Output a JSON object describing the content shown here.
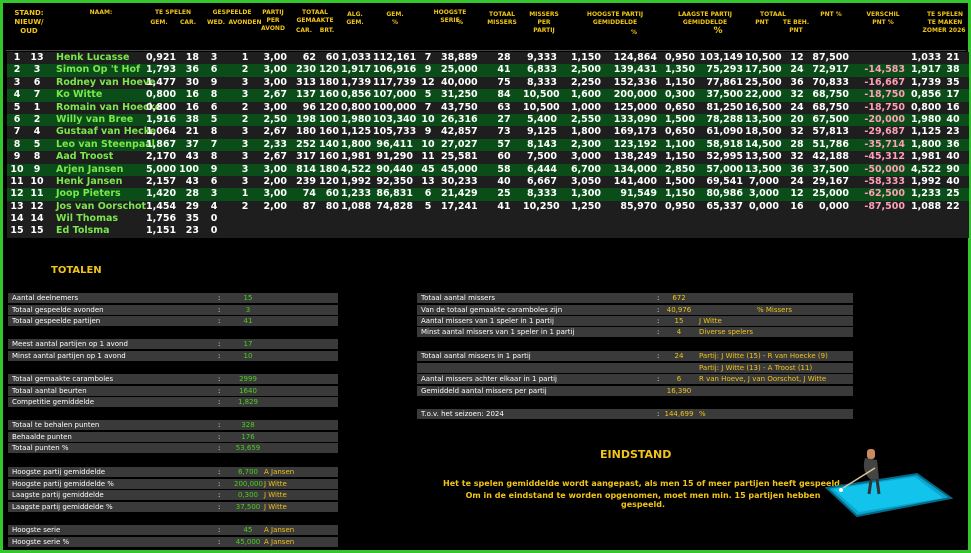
{
  "header": {
    "stand": "STAND:",
    "nieuw_oud": "NIEUW/ OUD",
    "naam": "NAAM:",
    "te_spelen": "TE SPELEN",
    "gem": "GEM.",
    "car": "CAR.",
    "gespeelde": "GESPEELDE",
    "wed": "WED.",
    "avonden": "AVONDEN",
    "partij_per_avond": "PARTIJ PER AVOND",
    "totaal_gemaakte": "TOTAAL GEMAAKTE",
    "car2": "CAR.",
    "brt": "BRT.",
    "alg_gem": "ALG. GEM.",
    "gem_pct": "GEM. %",
    "hoogste_serie": "HOOGSTE SERIE",
    "pct": "%",
    "totaal_missers": "TOTAAL MISSERS",
    "missers_per_partij": "MISSERS PER PARTIJ",
    "hoogste_partij_gemiddelde": "HOOGSTE PARTIJ GEMIDDELDE",
    "pct2": "%",
    "laagste_partij_gemiddelde": "LAAGSTE PARTIJ GEMIDDELDE",
    "pct3": "%",
    "totaal": "TOTAAL",
    "pnt": "PNT",
    "te_beh_pnt": "TE BEH. PNT",
    "pnt_pct": "PNT %",
    "verschil_pnt_pct": "VERSCHIL PNT %",
    "te_spelen_te_maken": "TE SPELEN TE MAKEN",
    "zomer": "ZOMER 2026"
  },
  "rows": [
    {
      "nieuw": "1",
      "oud": "13",
      "naam": "Henk Lucasse",
      "gem": "0,921",
      "car": "18",
      "wed": "3",
      "avonden": "1",
      "ppa": "3,00",
      "tcar": "62",
      "tbrt": "60",
      "alg": "1,033",
      "gpct": "112,161",
      "hs": "7",
      "hspct": "38,889",
      "miss": "28",
      "mpp": "9,333",
      "hpg": "1,150",
      "hpgpct": "124,864",
      "lpg": "0,950",
      "lpgpct": "103,149",
      "pnt": "10,500",
      "tbp": "12",
      "pntpct": "87,500",
      "versch": "",
      "zgem": "1,033",
      "zcar": "21"
    },
    {
      "nieuw": "2",
      "oud": "3",
      "naam": "Simon Op 't Hof",
      "gem": "1,793",
      "car": "36",
      "wed": "6",
      "avonden": "2",
      "ppa": "3,00",
      "tcar": "230",
      "tbrt": "120",
      "alg": "1,917",
      "gpct": "106,916",
      "hs": "9",
      "hspct": "25,000",
      "miss": "41",
      "mpp": "6,833",
      "hpg": "2,500",
      "hpgpct": "139,431",
      "lpg": "1,350",
      "lpgpct": "75,293",
      "pnt": "17,500",
      "tbp": "24",
      "pntpct": "72,917",
      "versch": "-14,583",
      "zgem": "1,917",
      "zcar": "38"
    },
    {
      "nieuw": "3",
      "oud": "6",
      "naam": "Rodney van Hoeve",
      "gem": "1,477",
      "car": "30",
      "wed": "9",
      "avonden": "3",
      "ppa": "3,00",
      "tcar": "313",
      "tbrt": "180",
      "alg": "1,739",
      "gpct": "117,739",
      "hs": "12",
      "hspct": "40,000",
      "miss": "75",
      "mpp": "8,333",
      "hpg": "2,250",
      "hpgpct": "152,336",
      "lpg": "1,150",
      "lpgpct": "77,861",
      "pnt": "25,500",
      "tbp": "36",
      "pntpct": "70,833",
      "versch": "-16,667",
      "zgem": "1,739",
      "zcar": "35"
    },
    {
      "nieuw": "4",
      "oud": "7",
      "naam": "Ko Witte",
      "gem": "0,800",
      "car": "16",
      "wed": "8",
      "avonden": "3",
      "ppa": "2,67",
      "tcar": "137",
      "tbrt": "160",
      "alg": "0,856",
      "gpct": "107,000",
      "hs": "5",
      "hspct": "31,250",
      "miss": "84",
      "mpp": "10,500",
      "hpg": "1,600",
      "hpgpct": "200,000",
      "lpg": "0,300",
      "lpgpct": "37,500",
      "pnt": "22,000",
      "tbp": "32",
      "pntpct": "68,750",
      "versch": "-18,750",
      "zgem": "0,856",
      "zcar": "17"
    },
    {
      "nieuw": "5",
      "oud": "1",
      "naam": "Romain van Hoecke",
      "gem": "0,800",
      "car": "16",
      "wed": "6",
      "avonden": "2",
      "ppa": "3,00",
      "tcar": "96",
      "tbrt": "120",
      "alg": "0,800",
      "gpct": "100,000",
      "hs": "7",
      "hspct": "43,750",
      "miss": "63",
      "mpp": "10,500",
      "hpg": "1,000",
      "hpgpct": "125,000",
      "lpg": "0,650",
      "lpgpct": "81,250",
      "pnt": "16,500",
      "tbp": "24",
      "pntpct": "68,750",
      "versch": "-18,750",
      "zgem": "0,800",
      "zcar": "16"
    },
    {
      "nieuw": "6",
      "oud": "2",
      "naam": "Willy van Bree",
      "gem": "1,916",
      "car": "38",
      "wed": "5",
      "avonden": "2",
      "ppa": "2,50",
      "tcar": "198",
      "tbrt": "100",
      "alg": "1,980",
      "gpct": "103,340",
      "hs": "10",
      "hspct": "26,316",
      "miss": "27",
      "mpp": "5,400",
      "hpg": "2,550",
      "hpgpct": "133,090",
      "lpg": "1,500",
      "lpgpct": "78,288",
      "pnt": "13,500",
      "tbp": "20",
      "pntpct": "67,500",
      "versch": "-20,000",
      "zgem": "1,980",
      "zcar": "40"
    },
    {
      "nieuw": "7",
      "oud": "4",
      "naam": "Gustaaf van Hecke",
      "gem": "1,064",
      "car": "21",
      "wed": "8",
      "avonden": "3",
      "ppa": "2,67",
      "tcar": "180",
      "tbrt": "160",
      "alg": "1,125",
      "gpct": "105,733",
      "hs": "9",
      "hspct": "42,857",
      "miss": "73",
      "mpp": "9,125",
      "hpg": "1,800",
      "hpgpct": "169,173",
      "lpg": "0,650",
      "lpgpct": "61,090",
      "pnt": "18,500",
      "tbp": "32",
      "pntpct": "57,813",
      "versch": "-29,687",
      "zgem": "1,125",
      "zcar": "23"
    },
    {
      "nieuw": "8",
      "oud": "5",
      "naam": "Leo van Steenpaal",
      "gem": "1,867",
      "car": "37",
      "wed": "7",
      "avonden": "3",
      "ppa": "2,33",
      "tcar": "252",
      "tbrt": "140",
      "alg": "1,800",
      "gpct": "96,411",
      "hs": "10",
      "hspct": "27,027",
      "miss": "57",
      "mpp": "8,143",
      "hpg": "2,300",
      "hpgpct": "123,192",
      "lpg": "1,100",
      "lpgpct": "58,918",
      "pnt": "14,500",
      "tbp": "28",
      "pntpct": "51,786",
      "versch": "-35,714",
      "zgem": "1,800",
      "zcar": "36"
    },
    {
      "nieuw": "9",
      "oud": "8",
      "naam": "Aad Troost",
      "gem": "2,170",
      "car": "43",
      "wed": "8",
      "avonden": "3",
      "ppa": "2,67",
      "tcar": "317",
      "tbrt": "160",
      "alg": "1,981",
      "gpct": "91,290",
      "hs": "11",
      "hspct": "25,581",
      "miss": "60",
      "mpp": "7,500",
      "hpg": "3,000",
      "hpgpct": "138,249",
      "lpg": "1,150",
      "lpgpct": "52,995",
      "pnt": "13,500",
      "tbp": "32",
      "pntpct": "42,188",
      "versch": "-45,312",
      "zgem": "1,981",
      "zcar": "40"
    },
    {
      "nieuw": "10",
      "oud": "9",
      "naam": "Arjen Jansen",
      "gem": "5,000",
      "car": "100",
      "wed": "9",
      "avonden": "3",
      "ppa": "3,00",
      "tcar": "814",
      "tbrt": "180",
      "alg": "4,522",
      "gpct": "90,440",
      "hs": "45",
      "hspct": "45,000",
      "miss": "58",
      "mpp": "6,444",
      "hpg": "6,700",
      "hpgpct": "134,000",
      "lpg": "2,850",
      "lpgpct": "57,000",
      "pnt": "13,500",
      "tbp": "36",
      "pntpct": "37,500",
      "versch": "-50,000",
      "zgem": "4,522",
      "zcar": "90"
    },
    {
      "nieuw": "11",
      "oud": "10",
      "naam": "Henk Jansen",
      "gem": "2,157",
      "car": "43",
      "wed": "6",
      "avonden": "3",
      "ppa": "2,00",
      "tcar": "239",
      "tbrt": "120",
      "alg": "1,992",
      "gpct": "92,350",
      "hs": "13",
      "hspct": "30,233",
      "miss": "40",
      "mpp": "6,667",
      "hpg": "3,050",
      "hpgpct": "141,400",
      "lpg": "1,500",
      "lpgpct": "69,541",
      "pnt": "7,000",
      "tbp": "24",
      "pntpct": "29,167",
      "versch": "-58,333",
      "zgem": "1,992",
      "zcar": "40"
    },
    {
      "nieuw": "12",
      "oud": "11",
      "naam": "Joop Pieters",
      "gem": "1,420",
      "car": "28",
      "wed": "3",
      "avonden": "1",
      "ppa": "3,00",
      "tcar": "74",
      "tbrt": "60",
      "alg": "1,233",
      "gpct": "86,831",
      "hs": "6",
      "hspct": "21,429",
      "miss": "25",
      "mpp": "8,333",
      "hpg": "1,300",
      "hpgpct": "91,549",
      "lpg": "1,150",
      "lpgpct": "80,986",
      "pnt": "3,000",
      "tbp": "12",
      "pntpct": "25,000",
      "versch": "-62,500",
      "zgem": "1,233",
      "zcar": "25"
    },
    {
      "nieuw": "13",
      "oud": "12",
      "naam": "Jos van Oorschot",
      "gem": "1,454",
      "car": "29",
      "wed": "4",
      "avonden": "2",
      "ppa": "2,00",
      "tcar": "87",
      "tbrt": "80",
      "alg": "1,088",
      "gpct": "74,828",
      "hs": "5",
      "hspct": "17,241",
      "miss": "41",
      "mpp": "10,250",
      "hpg": "1,250",
      "hpgpct": "85,970",
      "lpg": "0,950",
      "lpgpct": "65,337",
      "pnt": "0,000",
      "tbp": "16",
      "pntpct": "0,000",
      "versch": "-87,500",
      "zgem": "1,088",
      "zcar": "22"
    },
    {
      "nieuw": "14",
      "oud": "14",
      "naam": "Wil Thomas",
      "gem": "1,756",
      "car": "35",
      "wed": "0",
      "avonden": "",
      "ppa": "",
      "tcar": "",
      "tbrt": "",
      "alg": "",
      "gpct": "",
      "hs": "",
      "hspct": "",
      "miss": "",
      "mpp": "",
      "hpg": "",
      "hpgpct": "",
      "lpg": "",
      "lpgpct": "",
      "pnt": "",
      "tbp": "",
      "pntpct": "",
      "versch": "",
      "zgem": "",
      "zcar": ""
    },
    {
      "nieuw": "15",
      "oud": "15",
      "naam": "Ed Tolsma",
      "gem": "1,151",
      "car": "23",
      "wed": "0",
      "avonden": "",
      "ppa": "",
      "tcar": "",
      "tbrt": "",
      "alg": "",
      "gpct": "",
      "hs": "",
      "hspct": "",
      "miss": "",
      "mpp": "",
      "hpg": "",
      "hpgpct": "",
      "lpg": "",
      "lpgpct": "",
      "pnt": "",
      "tbp": "",
      "pntpct": "",
      "versch": "",
      "zgem": "",
      "zcar": ""
    }
  ],
  "totalen": {
    "title": "TOTALEN",
    "items": [
      {
        "label": "Aantal deelnemers",
        "sep": ":",
        "value": "15",
        "name": ""
      },
      {
        "label": "Totaal gespeelde avonden",
        "sep": ":",
        "value": "3",
        "name": ""
      },
      {
        "label": "Totaal gespeelde partijen",
        "sep": ":",
        "value": "41",
        "name": ""
      },
      {
        "label": "Meest aantal partijen op 1 avond",
        "sep": ":",
        "value": "17",
        "name": ""
      },
      {
        "label": "Minst aantal partijen op 1 avond",
        "sep": ":",
        "value": "10",
        "name": ""
      },
      {
        "label": "Totaal gemaakte caramboles",
        "sep": ":",
        "value": "2999",
        "name": ""
      },
      {
        "label": "Totaal aantal beurten",
        "sep": ":",
        "value": "1640",
        "name": ""
      },
      {
        "label": "Competitie gemiddelde",
        "sep": ":",
        "value": "1,829",
        "name": ""
      },
      {
        "label": "Totaal te behalen punten",
        "sep": ":",
        "value": "328",
        "name": ""
      },
      {
        "label": "Behaalde punten",
        "sep": ":",
        "value": "176",
        "name": ""
      },
      {
        "label": "Totaal punten %",
        "sep": ":",
        "value": "53,659",
        "name": ""
      },
      {
        "label": "Hoogste partij gemiddelde",
        "sep": ":",
        "value": "6,700",
        "name": "A Jansen"
      },
      {
        "label": "Hoogste partij gemiddelde %",
        "sep": ":",
        "value": "200,000",
        "name": "J Witte"
      },
      {
        "label": "Laagste partij gemiddelde",
        "sep": ":",
        "value": "0,300",
        "name": "J Witte"
      },
      {
        "label": "Laagste partij gemiddelde %",
        "sep": ":",
        "value": "37,500",
        "name": "J Witte"
      },
      {
        "label": "Hoogste serie",
        "sep": ":",
        "value": "45",
        "name": "A Jansen"
      },
      {
        "label": "Hoogste serie %",
        "sep": ":",
        "value": "45,000",
        "name": "A Jansen"
      }
    ]
  },
  "missers": {
    "items": [
      {
        "label": "Totaal aantal missers",
        "sep": ":",
        "value": "672",
        "extra": ""
      },
      {
        "label": "Van de totaal gemaakte caramboles zijn",
        "sep": ":",
        "value": "40,976",
        "extra": "% Missers"
      },
      {
        "label": "Aantal missers van 1 speler in 1 partij",
        "sep": ":",
        "value": "15",
        "extra": "J Witte"
      },
      {
        "label": "Minst aantal missers van 1 speler in 1 partij",
        "sep": ":",
        "value": "4",
        "extra": "Diverse spelers"
      },
      {
        "label": "Totaal aantal missers in 1 partij",
        "sep": ":",
        "value": "24",
        "extra": "Partij: J Witte (15) - R van Hoecke (9)"
      },
      {
        "label": "",
        "sep": "",
        "value": "",
        "extra": "Partij: J Witte (13) - A Troost (11)"
      },
      {
        "label": "Aantal missers achter elkaar in 1 partij",
        "sep": ":",
        "value": "6",
        "extra": "R van Hoeve, J van Oorschot, J Witte"
      },
      {
        "label": "Gemiddeld aantal missers per partij",
        "sep": "",
        "value": "16,390",
        "extra": ""
      },
      {
        "label": "T.o.v. het seizoen: 2024",
        "sep": ":",
        "value": "144,699",
        "extra": "%"
      }
    ]
  },
  "eindstand": {
    "title": "EINDSTAND",
    "line1": "Het te spelen gemiddelde wordt aangepast, als men 15 of meer partijen heeft gespeeld.",
    "line2": "Om in de eindstand te worden opgenomen, moet men min. 15 partijen hebben gespeeld."
  },
  "colors": {
    "border": "#35c62e",
    "accent": "#f0c419",
    "green_text": "#79e84b",
    "row_green": "#0b4d18",
    "negative": "#ff9fb8"
  },
  "icons": {
    "billiard": "billiard-player-icon"
  }
}
